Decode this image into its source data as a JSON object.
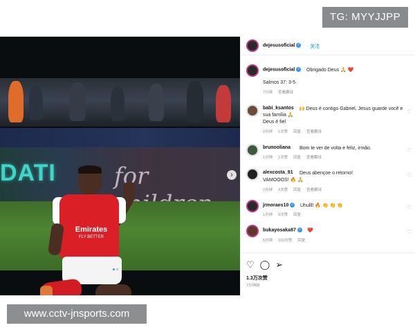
{
  "tg_badge": "TG: MYYJJPP",
  "site_badge": "www.cctv-jnsports.com",
  "photo": {
    "ad_left": "DATI",
    "ad_right": "for children",
    "sponsor_line1": "Emirates",
    "sponsor_line2": "FLY BETTER"
  },
  "header": {
    "username": "dejesusoficial",
    "follow_label": "· 关注"
  },
  "caption": {
    "username": "dejesusoficial",
    "text": "Obrigado Deus 🙏 ❤️",
    "line2": "Salmos 37: 3-5.",
    "time": "7分钟",
    "translate": "查看翻译"
  },
  "comments": [
    {
      "username": "babi_ksantos",
      "text": "🙌 Deus é contigo Gabriel, Jesus guarde você e sua família 🙏",
      "text2": "Deus é fiel",
      "time": "2分钟",
      "likes": "1次赞",
      "reply": "回复",
      "translate": "查看翻译"
    },
    {
      "username": "brunooliana",
      "text": "Bom te ver de volta e feliz, irmão.",
      "time": "1分钟",
      "likes": "1次赞",
      "reply": "回复",
      "translate": "查看翻译"
    },
    {
      "username": "alexcosta_91",
      "text": "Deus abençoe o retorno!",
      "text2": "VAMOOOS! 🔥 🙏",
      "time": "2分钟",
      "likes": "2次赞",
      "reply": "回复",
      "translate": "查看翻译"
    },
    {
      "username": "jrmoraes10",
      "text": "Uhulll! 🔥 👏 👏 👏",
      "time": "1分钟",
      "likes": "5次赞",
      "reply": "回复"
    },
    {
      "username": "bukayosaka87",
      "text": "❤️",
      "time": "5分钟",
      "likes": "333次赞",
      "reply": "回复"
    }
  ],
  "footer": {
    "likes": "1.3万次赞",
    "ago": "7分钟前"
  },
  "icons": [
    "heart-icon",
    "comment-icon",
    "share-icon",
    "next-arrow-icon",
    "verified-icon"
  ],
  "colors": {
    "accent": "#0095f6",
    "verified": "#3897f0",
    "shirt": "#db1f26"
  }
}
